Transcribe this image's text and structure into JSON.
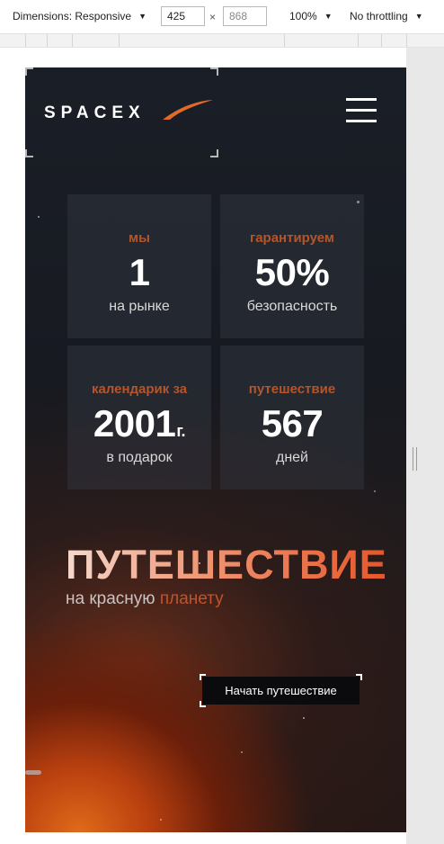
{
  "devtools": {
    "dimensions_label": "Dimensions: Responsive",
    "width_value": "425",
    "height_value": "868",
    "times": "×",
    "zoom": "100%",
    "throttling": "No throttling"
  },
  "header": {
    "logo_text": "SPACEX",
    "menu_icon": "hamburger-icon"
  },
  "stats": [
    {
      "label": "мы",
      "value": "1",
      "suffix": "",
      "sub": "на рынке"
    },
    {
      "label": "гарантируем",
      "value": "50%",
      "suffix": "",
      "sub": "безопасность"
    },
    {
      "label": "календарик за",
      "value": "2001",
      "suffix": "г.",
      "sub": "в подарок"
    },
    {
      "label": "путешествие",
      "value": "567",
      "suffix": "",
      "sub": "дней"
    }
  ],
  "hero": {
    "title": "ПУТЕШЕСТВИЕ",
    "subtitle_prefix": "на красную",
    "subtitle_accent": "планету",
    "cta_label": "Начать путешествие"
  },
  "colors": {
    "accent": "#c2532a",
    "background": "#171a21"
  }
}
